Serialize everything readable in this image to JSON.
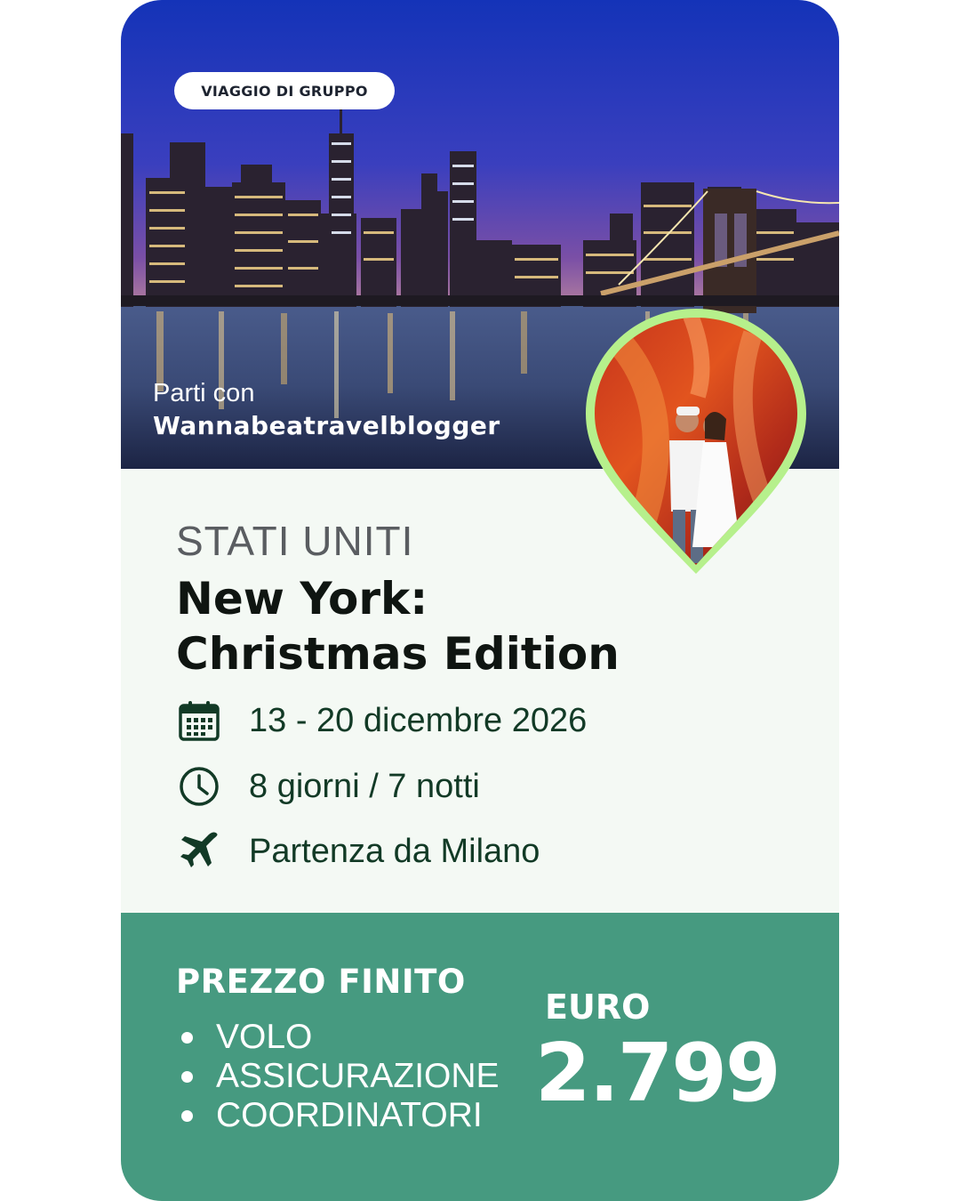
{
  "badge": "VIAGGIO DI GRUPPO",
  "host": {
    "prefix": "Parti con",
    "name": "Wannabeatravelblogger"
  },
  "trip": {
    "country": "STATI UNITI",
    "title_line1": "New York:",
    "title_line2": "Christmas Edition"
  },
  "details": [
    {
      "icon": "calendar-icon",
      "text": "13 - 20 dicembre 2026"
    },
    {
      "icon": "clock-icon",
      "text": "8 giorni / 7 notti"
    },
    {
      "icon": "airplane-icon",
      "text": "Partenza da Milano"
    }
  ],
  "price": {
    "label": "PREZZO FINITO",
    "includes": [
      "VOLO",
      "ASSICURAZIONE",
      "COORDINATORI"
    ],
    "currency": "EURO",
    "amount": "2.799"
  },
  "colors": {
    "panel": "#469a80",
    "card_bg": "#f4f9f4",
    "pin_border": "#b6f08c",
    "text_dark": "#0f1511",
    "detail_text": "#123a26"
  }
}
